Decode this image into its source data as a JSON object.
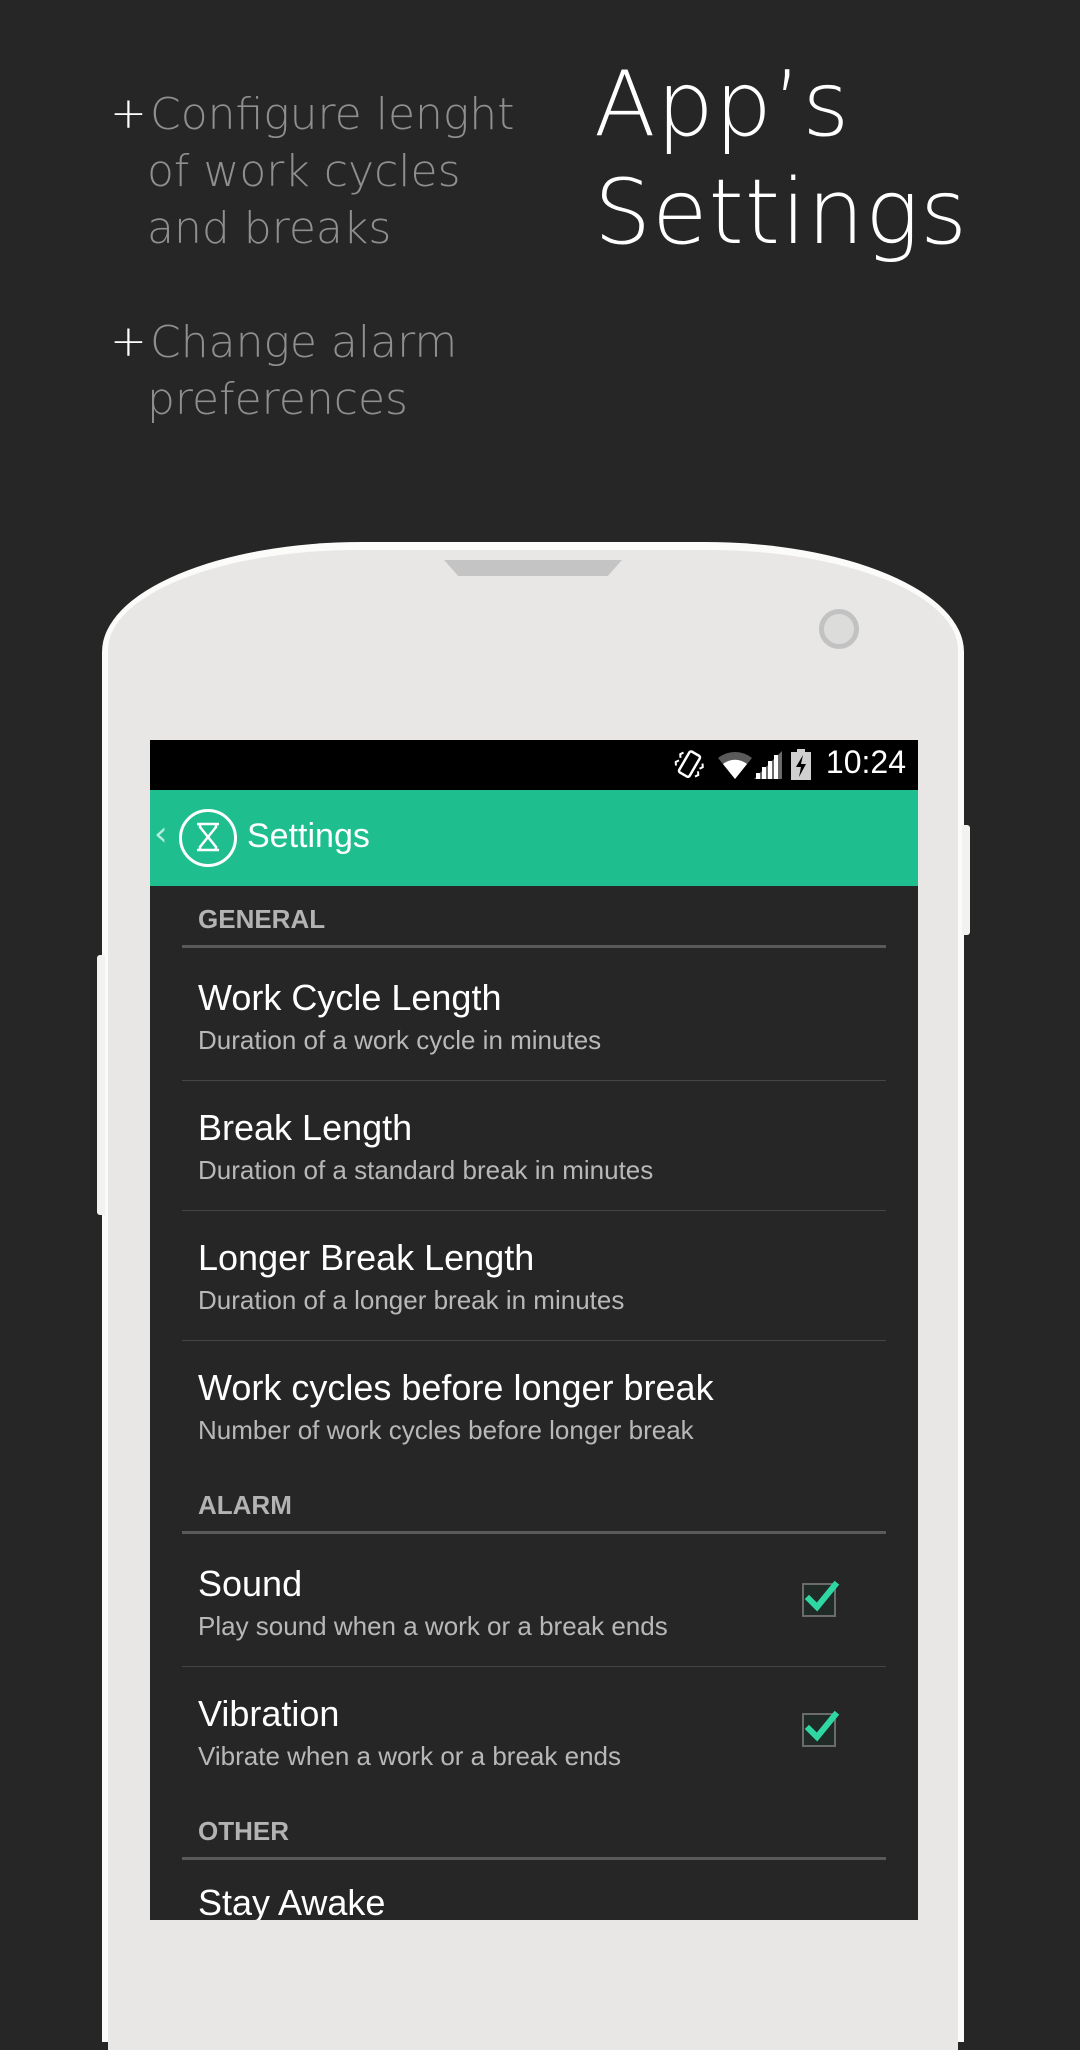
{
  "promo": {
    "bullet_symbol": "+",
    "bullet1_lines": [
      "Configure lenght",
      "of work cycles",
      "and breaks"
    ],
    "bullet2_lines": [
      "Change alarm",
      "preferences"
    ],
    "headline_lines": [
      "App’s",
      "Settings"
    ]
  },
  "status_bar": {
    "time": "10:24",
    "icons": [
      "vibrate-icon",
      "wifi-icon",
      "signal-icon",
      "battery-charging-icon"
    ]
  },
  "action_bar": {
    "up_icon": "chevron-left-icon",
    "app_icon": "hourglass-icon",
    "title": "Settings"
  },
  "sections": {
    "general": {
      "header": "GENERAL",
      "items": [
        {
          "title": "Work Cycle Length",
          "summary": "Duration of a work cycle in minutes"
        },
        {
          "title": "Break Length",
          "summary": "Duration of a standard break in minutes"
        },
        {
          "title": "Longer Break Length",
          "summary": "Duration of a longer break in minutes"
        },
        {
          "title": "Work cycles before longer break",
          "summary": "Number of work cycles before longer break"
        }
      ]
    },
    "alarm": {
      "header": "ALARM",
      "items": [
        {
          "title": "Sound",
          "summary": "Play sound when a work or a break ends",
          "checked": true
        },
        {
          "title": "Vibration",
          "summary": "Vibrate when a work or a break ends",
          "checked": true
        }
      ]
    },
    "other": {
      "header": "OTHER",
      "items": [
        {
          "title": "Stay Awake"
        }
      ]
    }
  },
  "colors": {
    "background": "#262626",
    "accent": "#1fbe8e",
    "check": "#2fd8a2",
    "device": "#e8e7e5"
  }
}
